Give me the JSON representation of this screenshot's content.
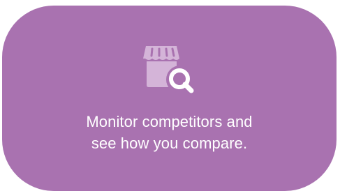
{
  "card": {
    "icon": "storefront-search-icon",
    "caption_line1": "Monitor competitors and",
    "caption_line2": "see how you compare.",
    "background_color": "#a972b0",
    "text_color": "#ffffff"
  }
}
